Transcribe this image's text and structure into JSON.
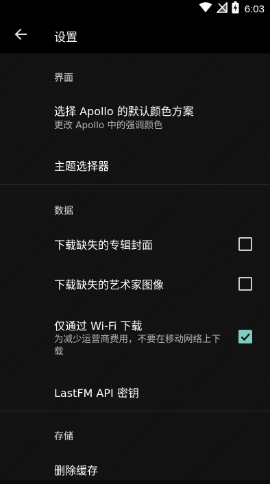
{
  "status_bar": {
    "time": "6:03",
    "icons": [
      "wifi-icon",
      "no-signal-icon",
      "battery-charging-icon"
    ]
  },
  "toolbar": {
    "back_icon": "arrow-back-icon",
    "title": "设置"
  },
  "sections": {
    "interface": {
      "header": "界面",
      "color_scheme": {
        "title": "选择 Apollo 的默认颜色方案",
        "summary": "更改 Apollo 中的强调颜色"
      },
      "theme_chooser": {
        "title": "主题选择器"
      }
    },
    "data": {
      "header": "数据",
      "download_artwork": {
        "title": "下载缺失的专辑封面",
        "checked": false
      },
      "download_artist_images": {
        "title": "下载缺失的艺术家图像",
        "checked": false
      },
      "wifi_only": {
        "title": "仅通过 Wi-Fi 下载",
        "summary": "为减少运营商费用，不要在移动网络上下载",
        "checked": true
      },
      "lastfm_key": {
        "title": "LastFM API 密钥"
      }
    },
    "storage": {
      "header": "存储",
      "delete_cache": {
        "title": "删除缓存"
      }
    }
  },
  "colors": {
    "accent": "#80cbc4",
    "background": "#111111",
    "bar": "#000000"
  }
}
